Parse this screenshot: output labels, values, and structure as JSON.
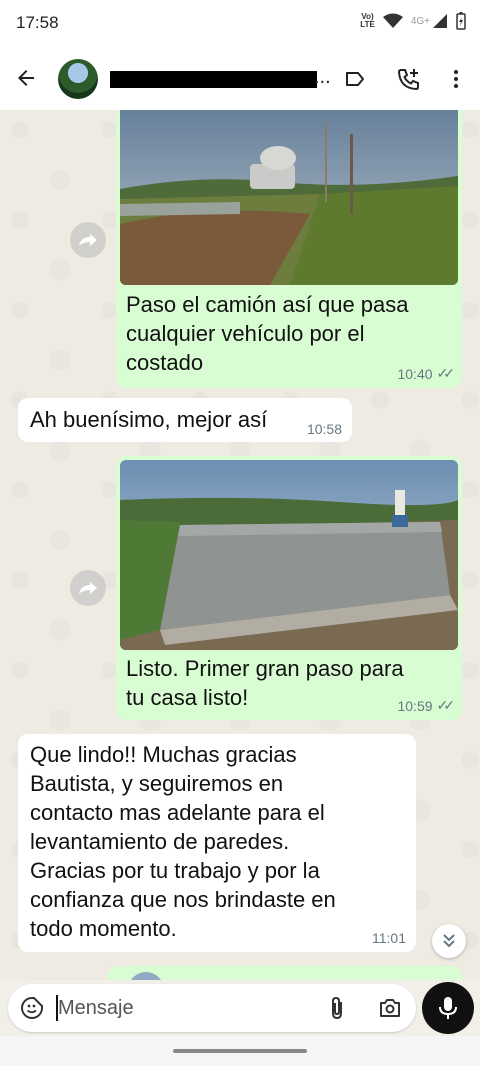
{
  "status_bar": {
    "time": "17:58",
    "volte_top": "Vo)",
    "volte_bottom": "LTE",
    "network": "4G+"
  },
  "header": {
    "contact_name_visible": "...",
    "icons": [
      "back-arrow-icon",
      "label-icon",
      "add-call-icon",
      "more-vert-icon"
    ]
  },
  "messages": [
    {
      "direction": "out",
      "has_image": true,
      "image_desc_icon": "photo-concrete-truck",
      "text": "Paso el camión así que pasa cualquier vehículo por el costado",
      "lines": [
        "Paso el camión así que pasa",
        "cualquier vehículo por el",
        "costado"
      ],
      "time": "10:40",
      "status": "read"
    },
    {
      "direction": "in",
      "text": "Ah buenísimo, mejor así",
      "time": "10:58"
    },
    {
      "direction": "out",
      "has_image": true,
      "image_desc_icon": "photo-concrete-slab",
      "text": "Listo. Primer gran paso para tu casa listo!",
      "lines": [
        "Listo. Primer gran paso para",
        "tu casa listo!"
      ],
      "time": "10:59",
      "status": "read"
    },
    {
      "direction": "in",
      "text": "Que lindo!! Muchas gracias Bautista, y seguiremos en contacto mas adelante para el levantamiento de paredes. Gracias por tu trabajo y por la confianza que nos brindaste en todo momento.",
      "lines": [
        "Que lindo!! Muchas gracias",
        "Bautista, y seguiremos en",
        "contacto mas adelante para el",
        "levantamiento de paredes.",
        "Gracias por tu trabajo y por la",
        "confianza que nos brindaste en",
        "todo momento."
      ],
      "time": "11:01"
    }
  ],
  "composer": {
    "placeholder": "Mensaje"
  },
  "colors": {
    "outgoing_bubble": "#d9fdd3",
    "incoming_bubble": "#ffffff",
    "chat_background": "#efeae2",
    "mic_button": "#111111"
  }
}
